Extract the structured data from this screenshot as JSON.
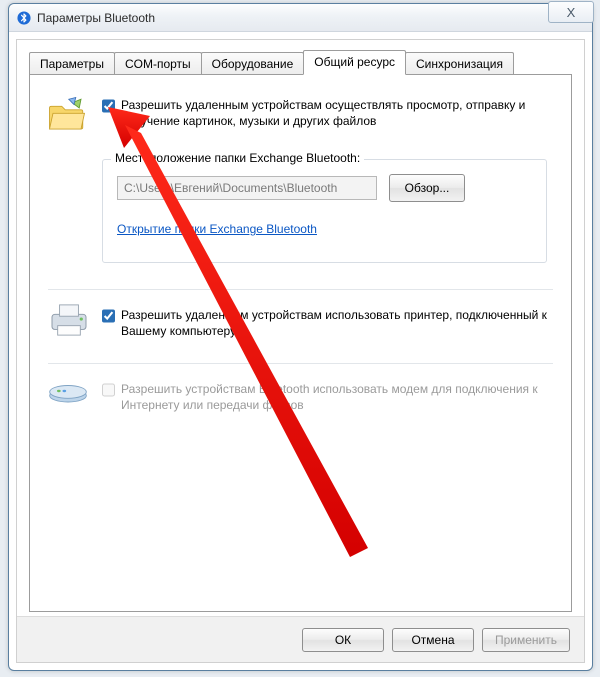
{
  "window": {
    "title": "Параметры Bluetooth",
    "close_glyph": "X"
  },
  "tabs": {
    "t0": "Параметры",
    "t1": "COM-порты",
    "t2": "Оборудование",
    "t3": "Общий ресурс",
    "t4": "Синхронизация"
  },
  "share": {
    "files_label": "Разрешить удаленным устройствам осуществлять просмотр, отправку и получение картинок, музыки и других файлов",
    "group_legend": "Местоположение папки Exchange Bluetooth:",
    "path_value": "C:\\Users\\Евгений\\Documents\\Bluetooth",
    "browse_label": "Обзор...",
    "open_link": "Открытие папки Exchange Bluetooth",
    "printer_label": "Разрешить удаленным устройствам использовать принтер, подключенный к Вашему компьютеру",
    "modem_label": "Разрешить устройствам Bluetooth использовать модем для подключения к Интернету или передачи факсов"
  },
  "buttons": {
    "ok": "ОК",
    "cancel": "Отмена",
    "apply": "Применить"
  }
}
